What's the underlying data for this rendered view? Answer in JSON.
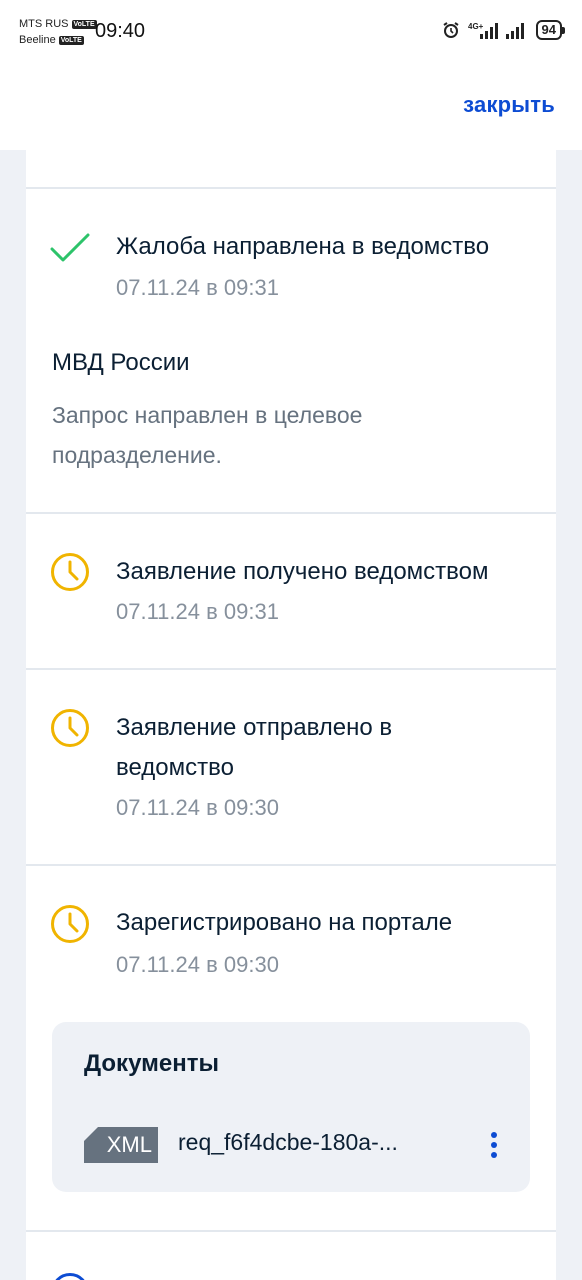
{
  "status_bar": {
    "carrier1": "MTS RUS",
    "carrier2": "Beeline",
    "volte": "VoLTE",
    "time": "09:40",
    "network": "4G+",
    "battery": "94"
  },
  "header": {
    "close_label": "закрыть"
  },
  "events": [
    {
      "title": "Жалоба направлена в ведомство",
      "date": "07.11.24 в 09:31",
      "status": "done",
      "icon": "checkmark-icon"
    },
    {
      "title": "Заявление получено ведомством",
      "date": "07.11.24 в 09:31",
      "status": "pending",
      "icon": "clock-icon"
    },
    {
      "title_line1": "Заявление отправлено в",
      "title_line2": "ведомство",
      "date": "07.11.24 в 09:30",
      "status": "pending",
      "icon": "clock-icon"
    },
    {
      "title": "Зарегистрировано на портале",
      "date": "07.11.24 в 09:30",
      "status": "pending",
      "icon": "clock-icon"
    }
  ],
  "department": {
    "name": "МВД России",
    "description": "Запрос направлен в целевое подразделение."
  },
  "documents": {
    "title": "Документы",
    "items": [
      {
        "type": "XML",
        "name": "req_f6f4dcbe-180a-..."
      }
    ]
  },
  "colors": {
    "accent": "#0d4cd3",
    "success": "#2dc36a",
    "pending": "#f0b400",
    "muted": "#86909c"
  }
}
